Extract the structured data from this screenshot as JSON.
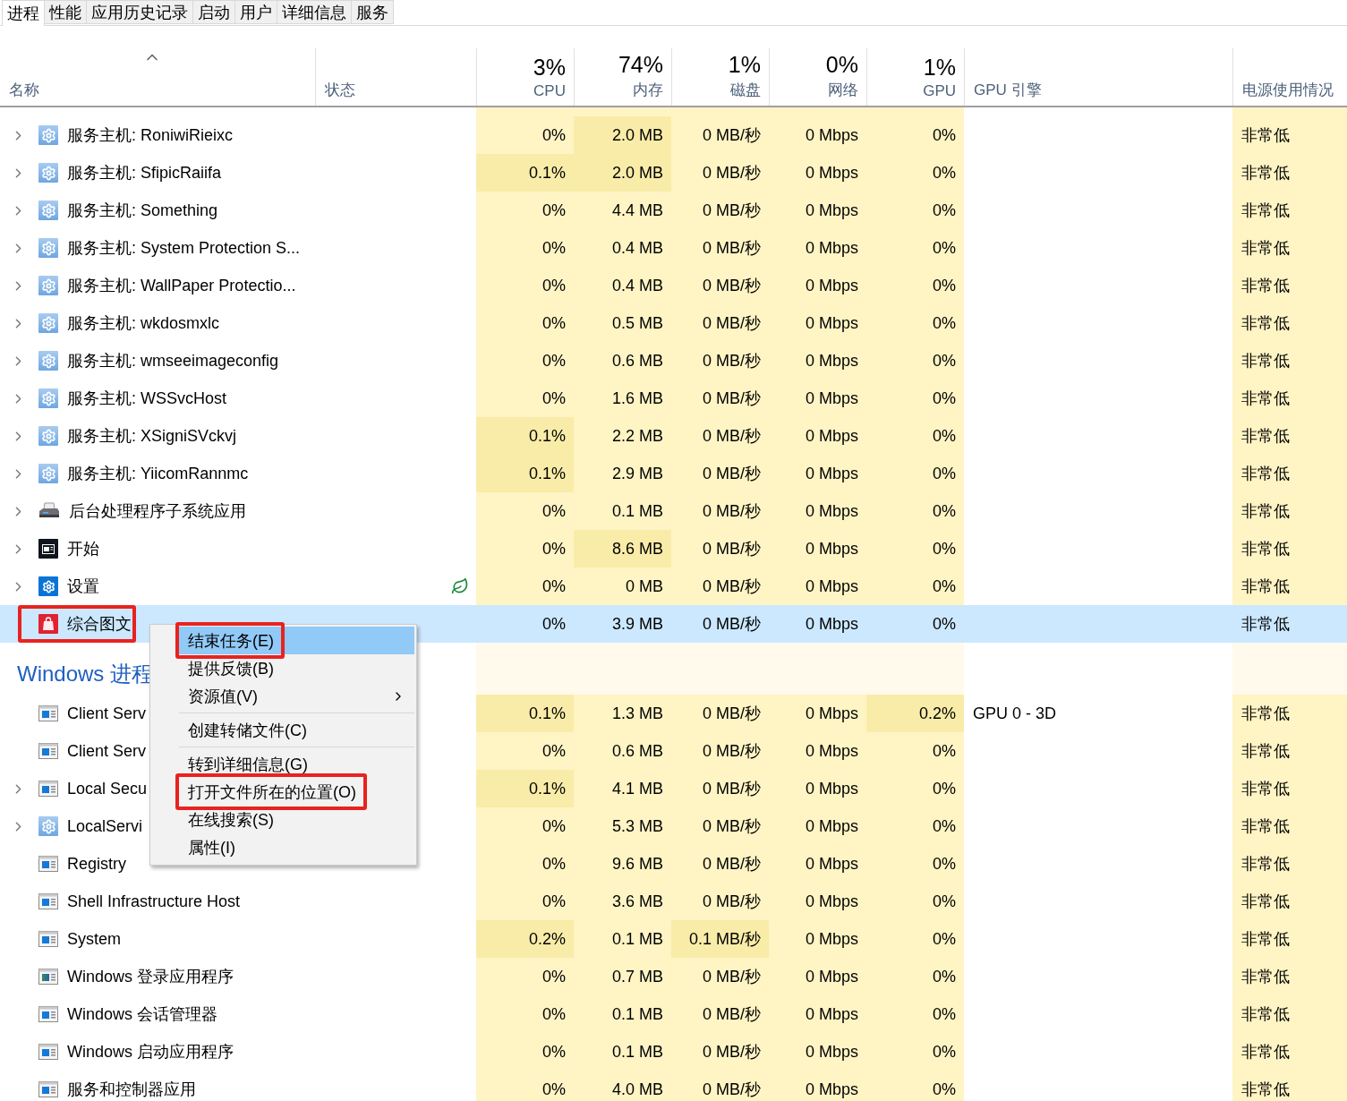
{
  "tabs": [
    {
      "label": "进程",
      "selected": true
    },
    {
      "label": "性能",
      "selected": false
    },
    {
      "label": "应用历史记录",
      "selected": false
    },
    {
      "label": "启动",
      "selected": false
    },
    {
      "label": "用户",
      "selected": false
    },
    {
      "label": "详细信息",
      "selected": false
    },
    {
      "label": "服务",
      "selected": false
    }
  ],
  "columns": {
    "name": {
      "label": "名称",
      "sorted": true
    },
    "status": {
      "label": "状态"
    },
    "cpu": {
      "total": "3%",
      "label": "CPU"
    },
    "memory": {
      "total": "74%",
      "label": "内存"
    },
    "disk": {
      "total": "1%",
      "label": "磁盘"
    },
    "network": {
      "total": "0%",
      "label": "网络"
    },
    "gpu": {
      "total": "1%",
      "label": "GPU"
    },
    "gpu_engine": {
      "label": "GPU 引擎"
    },
    "power": {
      "label": "电源使用情况"
    }
  },
  "process_rows": [
    {
      "name": "服务主机: RoniwiRieixc",
      "kind": "gear",
      "expandable": true,
      "selected": false,
      "eco": false,
      "hot": {
        "memory": true
      },
      "cpu": "0%",
      "memory": "2.0 MB",
      "disk": "0 MB/秒",
      "network": "0 Mbps",
      "gpu": "0%",
      "power": "非常低"
    },
    {
      "name": "服务主机: SfipicRaiifa",
      "kind": "gear",
      "expandable": true,
      "selected": false,
      "eco": false,
      "hot": {
        "cpu": true,
        "memory": true
      },
      "cpu": "0.1%",
      "memory": "2.0 MB",
      "disk": "0 MB/秒",
      "network": "0 Mbps",
      "gpu": "0%",
      "power": "非常低"
    },
    {
      "name": "服务主机: Something",
      "kind": "gear",
      "expandable": true,
      "selected": false,
      "eco": false,
      "cpu": "0%",
      "memory": "4.4 MB",
      "disk": "0 MB/秒",
      "network": "0 Mbps",
      "gpu": "0%",
      "power": "非常低"
    },
    {
      "name": "服务主机: System Protection S...",
      "kind": "gear",
      "expandable": true,
      "selected": false,
      "eco": false,
      "cpu": "0%",
      "memory": "0.4 MB",
      "disk": "0 MB/秒",
      "network": "0 Mbps",
      "gpu": "0%",
      "power": "非常低"
    },
    {
      "name": "服务主机: WallPaper Protectio...",
      "kind": "gear",
      "expandable": true,
      "selected": false,
      "eco": false,
      "cpu": "0%",
      "memory": "0.4 MB",
      "disk": "0 MB/秒",
      "network": "0 Mbps",
      "gpu": "0%",
      "power": "非常低"
    },
    {
      "name": "服务主机: wkdosmxlc",
      "kind": "gear",
      "expandable": true,
      "selected": false,
      "eco": false,
      "cpu": "0%",
      "memory": "0.5 MB",
      "disk": "0 MB/秒",
      "network": "0 Mbps",
      "gpu": "0%",
      "power": "非常低"
    },
    {
      "name": "服务主机: wmseeimageconfig",
      "kind": "gear",
      "expandable": true,
      "selected": false,
      "eco": false,
      "cpu": "0%",
      "memory": "0.6 MB",
      "disk": "0 MB/秒",
      "network": "0 Mbps",
      "gpu": "0%",
      "power": "非常低"
    },
    {
      "name": "服务主机: WSSvcHost",
      "kind": "gear",
      "expandable": true,
      "selected": false,
      "eco": false,
      "cpu": "0%",
      "memory": "1.6 MB",
      "disk": "0 MB/秒",
      "network": "0 Mbps",
      "gpu": "0%",
      "power": "非常低"
    },
    {
      "name": "服务主机: XSigniSVckvj",
      "kind": "gear",
      "expandable": true,
      "selected": false,
      "eco": false,
      "hot": {
        "cpu": true
      },
      "cpu": "0.1%",
      "memory": "2.2 MB",
      "disk": "0 MB/秒",
      "network": "0 Mbps",
      "gpu": "0%",
      "power": "非常低"
    },
    {
      "name": "服务主机: YiicomRannmc",
      "kind": "gear",
      "expandable": true,
      "selected": false,
      "eco": false,
      "hot": {
        "cpu": true
      },
      "cpu": "0.1%",
      "memory": "2.9 MB",
      "disk": "0 MB/秒",
      "network": "0 Mbps",
      "gpu": "0%",
      "power": "非常低"
    },
    {
      "name": "后台处理程序子系统应用",
      "kind": "printer",
      "expandable": true,
      "selected": false,
      "eco": false,
      "cpu": "0%",
      "memory": "0.1 MB",
      "disk": "0 MB/秒",
      "network": "0 Mbps",
      "gpu": "0%",
      "power": "非常低"
    },
    {
      "name": "开始",
      "kind": "start",
      "expandable": true,
      "selected": false,
      "eco": false,
      "hot": {
        "memory": true
      },
      "cpu": "0%",
      "memory": "8.6 MB",
      "disk": "0 MB/秒",
      "network": "0 Mbps",
      "gpu": "0%",
      "power": "非常低"
    },
    {
      "name": "设置",
      "kind": "settings",
      "expandable": true,
      "selected": false,
      "eco": true,
      "cpu": "0%",
      "memory": "0 MB",
      "disk": "0 MB/秒",
      "network": "0 Mbps",
      "gpu": "0%",
      "power": "非常低"
    },
    {
      "name": "综合图文",
      "kind": "bag",
      "expandable": false,
      "selected": true,
      "eco": false,
      "outlined": true,
      "cpu": "0%",
      "memory": "3.9 MB",
      "disk": "0 MB/秒",
      "network": "0 Mbps",
      "gpu": "0%",
      "power": "非常低"
    }
  ],
  "windows_section": {
    "title": "Windows 进程",
    "rows": [
      {
        "name": "Client Serv",
        "kind": "window",
        "expandable": false,
        "selected": false,
        "eco": false,
        "hot": {
          "cpu": true,
          "gpu": true
        },
        "cpu": "0.1%",
        "memory": "1.3 MB",
        "disk": "0 MB/秒",
        "network": "0 Mbps",
        "gpu": "0.2%",
        "gpu_engine": "GPU 0 - 3D",
        "power": "非常低"
      },
      {
        "name": "Client Serv",
        "kind": "window",
        "expandable": false,
        "selected": false,
        "eco": false,
        "cpu": "0%",
        "memory": "0.6 MB",
        "disk": "0 MB/秒",
        "network": "0 Mbps",
        "gpu": "0%",
        "power": "非常低"
      },
      {
        "name": "Local Secu",
        "kind": "window",
        "expandable": true,
        "selected": false,
        "eco": false,
        "hot": {
          "cpu": true
        },
        "cpu": "0.1%",
        "memory": "4.1 MB",
        "disk": "0 MB/秒",
        "network": "0 Mbps",
        "gpu": "0%",
        "power": "非常低"
      },
      {
        "name": "LocalServi",
        "kind": "gear",
        "expandable": true,
        "selected": false,
        "eco": false,
        "cpu": "0%",
        "memory": "5.3 MB",
        "disk": "0 MB/秒",
        "network": "0 Mbps",
        "gpu": "0%",
        "power": "非常低"
      },
      {
        "name": "Registry",
        "kind": "window",
        "expandable": false,
        "selected": false,
        "eco": false,
        "cpu": "0%",
        "memory": "9.6 MB",
        "disk": "0 MB/秒",
        "network": "0 Mbps",
        "gpu": "0%",
        "power": "非常低"
      },
      {
        "name": "Shell Infrastructure Host",
        "kind": "window",
        "expandable": false,
        "selected": false,
        "eco": false,
        "cpu": "0%",
        "memory": "3.6 MB",
        "disk": "0 MB/秒",
        "network": "0 Mbps",
        "gpu": "0%",
        "power": "非常低"
      },
      {
        "name": "System",
        "kind": "window",
        "expandable": false,
        "selected": false,
        "eco": false,
        "hot": {
          "cpu": true,
          "disk": true
        },
        "cpu": "0.2%",
        "memory": "0.1 MB",
        "disk": "0.1 MB/秒",
        "network": "0 Mbps",
        "gpu": "0%",
        "power": "非常低"
      },
      {
        "name": "Windows 登录应用程序",
        "kind": "window-green",
        "expandable": false,
        "selected": false,
        "eco": false,
        "cpu": "0%",
        "memory": "0.7 MB",
        "disk": "0 MB/秒",
        "network": "0 Mbps",
        "gpu": "0%",
        "power": "非常低"
      },
      {
        "name": "Windows 会话管理器",
        "kind": "window",
        "expandable": false,
        "selected": false,
        "eco": false,
        "cpu": "0%",
        "memory": "0.1 MB",
        "disk": "0 MB/秒",
        "network": "0 Mbps",
        "gpu": "0%",
        "power": "非常低"
      },
      {
        "name": "Windows 启动应用程序",
        "kind": "window",
        "expandable": false,
        "selected": false,
        "eco": false,
        "cpu": "0%",
        "memory": "0.1 MB",
        "disk": "0 MB/秒",
        "network": "0 Mbps",
        "gpu": "0%",
        "power": "非常低"
      },
      {
        "name": "服务和控制器应用",
        "kind": "window",
        "expandable": false,
        "selected": false,
        "eco": false,
        "cpu": "0%",
        "memory": "4.0 MB",
        "disk": "0 MB/秒",
        "network": "0 Mbps",
        "gpu": "0%",
        "power": "非常低"
      }
    ]
  },
  "context_menu": [
    {
      "label": "结束任务(E)",
      "selected": true,
      "outlined": true
    },
    {
      "label": "提供反馈(B)",
      "selected": false
    },
    {
      "label": "资源值(V)",
      "selected": false,
      "submenu": true
    },
    {
      "label": "创建转储文件(C)",
      "selected": false,
      "separator_before": true
    },
    {
      "label": "转到详细信息(G)",
      "selected": false,
      "separator_before": true
    },
    {
      "label": "打开文件所在的位置(O)",
      "selected": false,
      "outlined": true
    },
    {
      "label": "在线搜索(S)",
      "selected": false
    },
    {
      "label": "属性(I)",
      "selected": false
    }
  ]
}
